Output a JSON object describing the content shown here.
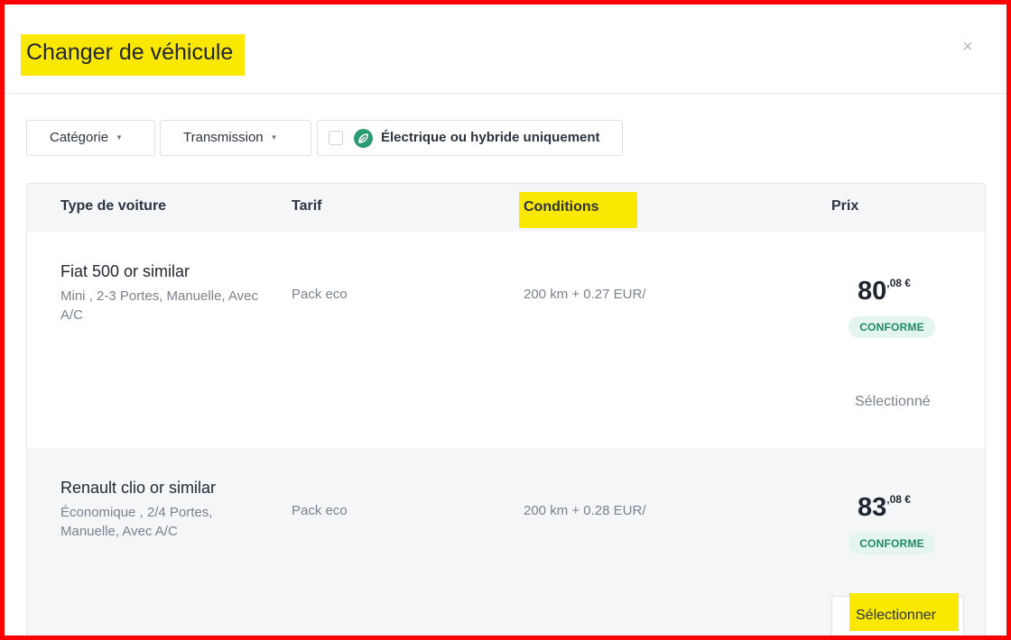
{
  "modal": {
    "title": "Changer de véhicule",
    "close_glyph": "×"
  },
  "filters": {
    "category_label": "Catégorie",
    "transmission_label": "Transmission",
    "electric_label": "Électrique ou hybride uniquement",
    "electric_checked": false,
    "caret_glyph": "▼"
  },
  "table": {
    "headers": {
      "car_type": "Type de voiture",
      "tarif": "Tarif",
      "conditions": "Conditions",
      "price": "Prix"
    },
    "rows": [
      {
        "name": "Fiat 500 or similar",
        "spec": "Mini , 2-3 Portes, Manuelle, Avec A/C",
        "tarif": "Pack eco",
        "conditions": "200 km + 0.27 EUR/",
        "price_int": "80",
        "price_dec": ",08 €",
        "badge": "CONFORME",
        "action": "Sélectionné",
        "is_selected": true
      },
      {
        "name": "Renault clio or similar",
        "spec": "Économique , 2/4 Portes, Manuelle, Avec A/C",
        "tarif": "Pack eco",
        "conditions": "200 km + 0.28 EUR/",
        "price_int": "83",
        "price_dec": ",08 €",
        "badge": "CONFORME",
        "action": "Sélectionner",
        "is_selected": false
      }
    ]
  },
  "colors": {
    "highlight": "#fbe800",
    "frame_border": "#ff0000",
    "badge_bg": "#e3f5ee",
    "badge_text": "#1e8a62",
    "leaf": "#2a9a6f"
  },
  "icons": {
    "close": "close-icon",
    "caret": "caret-down-icon",
    "leaf": "leaf-icon"
  }
}
